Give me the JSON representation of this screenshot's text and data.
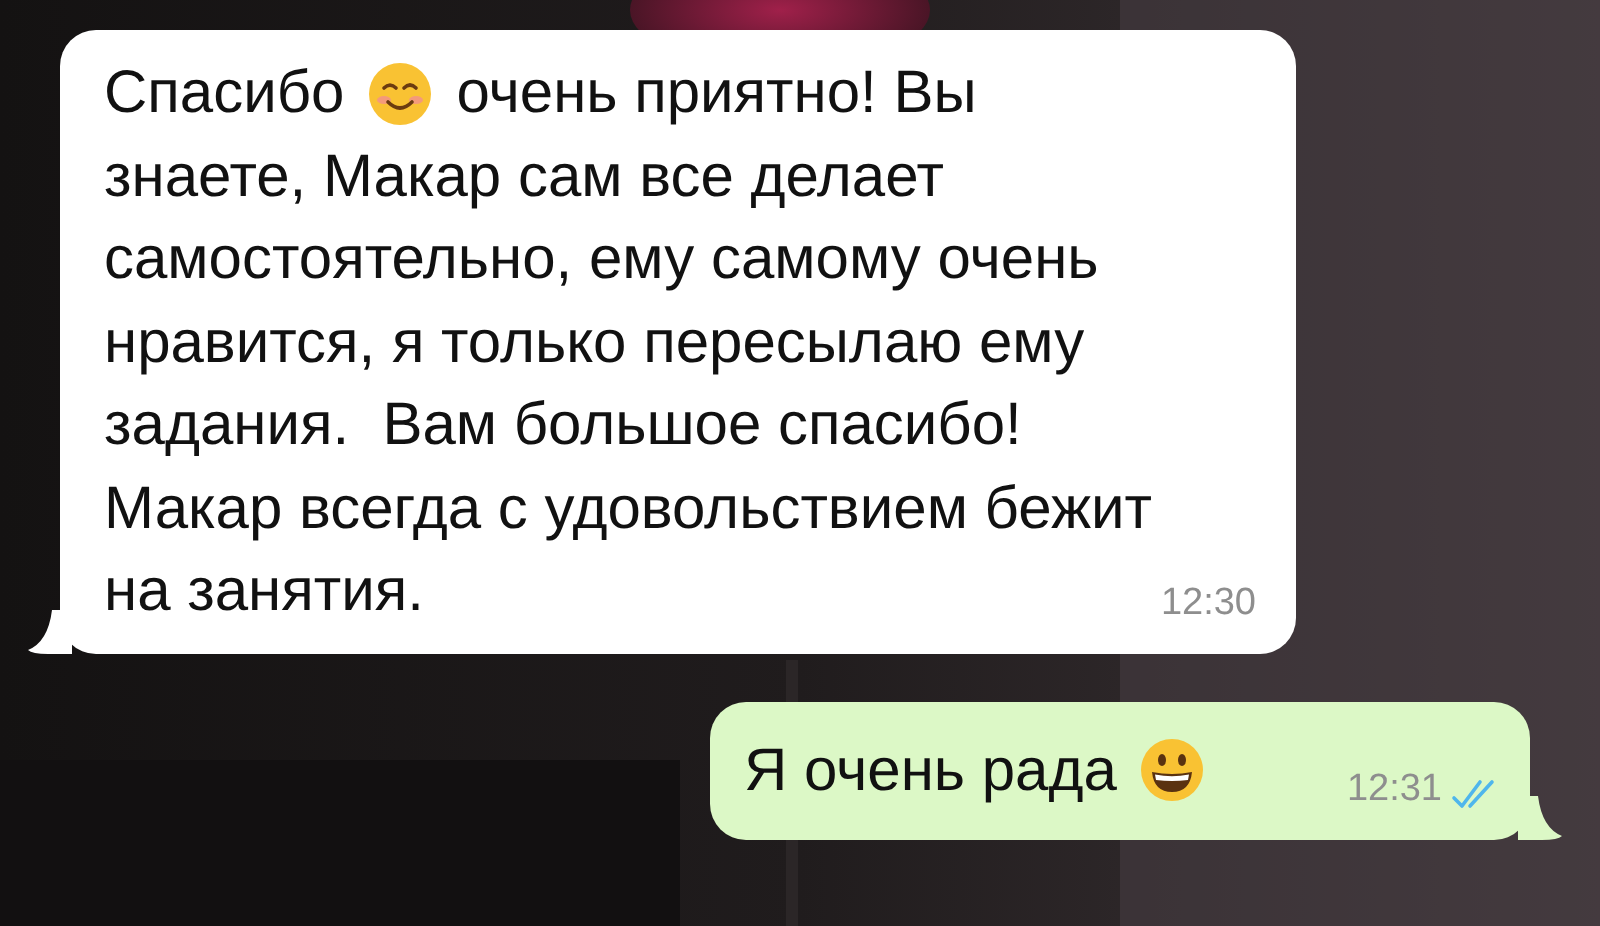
{
  "messages": [
    {
      "kind": "incoming",
      "time": "12:30",
      "lines": [
        [
          {
            "kind": "text",
            "text": "Спасибо"
          },
          {
            "kind": "smile"
          },
          {
            "kind": "text",
            "text": "очень приятно! Вы"
          }
        ],
        [
          {
            "kind": "text",
            "text": "знаете, Макар сам все делает"
          }
        ],
        [
          {
            "kind": "text",
            "text": "самостоятельно, ему самому очень"
          }
        ],
        [
          {
            "kind": "text",
            "text": "нравится, я только пересылаю ему"
          }
        ],
        [
          {
            "kind": "text",
            "text": "задания.  Вам большое спасибо!"
          }
        ],
        [
          {
            "kind": "text",
            "text": "Макар всегда с удовольствием бежит"
          }
        ],
        [
          {
            "kind": "text",
            "text": "на занятия."
          }
        ]
      ]
    },
    {
      "kind": "outgoing",
      "time": "12:31",
      "read": true,
      "lines": [
        [
          {
            "kind": "text",
            "text": "Я очень рада"
          },
          {
            "kind": "grin"
          }
        ]
      ]
    }
  ]
}
